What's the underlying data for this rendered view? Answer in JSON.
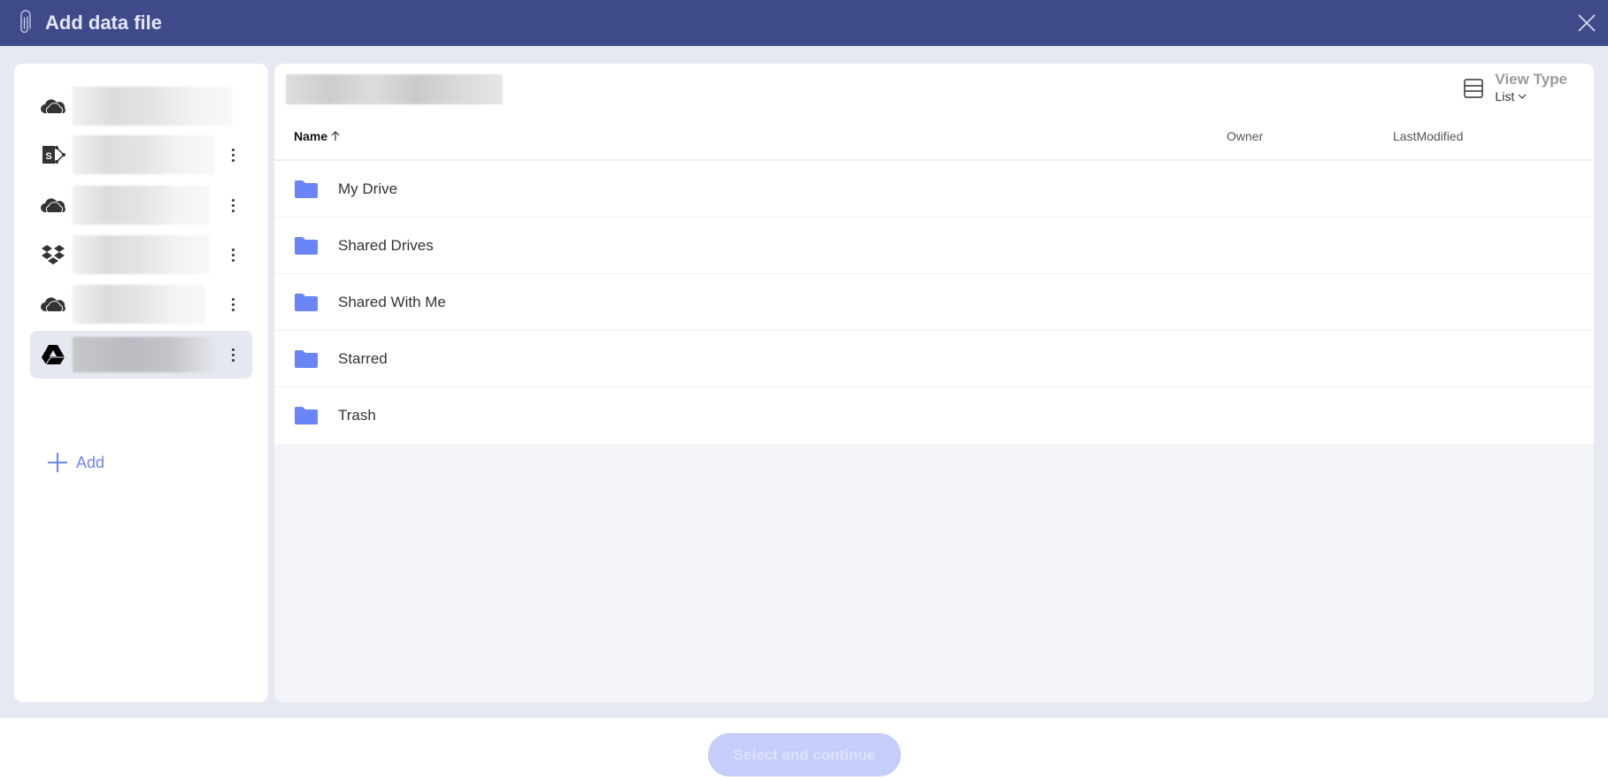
{
  "header": {
    "title": "Add data file",
    "icon": "paperclip-icon",
    "close_icon": "close-icon"
  },
  "sidebar": {
    "accounts": [
      {
        "icon": "onedrive-icon",
        "label": "",
        "selected": false,
        "has_menu": false
      },
      {
        "icon": "sharepoint-icon",
        "label": "",
        "selected": false,
        "has_menu": true
      },
      {
        "icon": "onedrive-icon",
        "label": "",
        "selected": false,
        "has_menu": true
      },
      {
        "icon": "dropbox-icon",
        "label": "",
        "selected": false,
        "has_menu": true
      },
      {
        "icon": "onedrive-icon",
        "label": "",
        "selected": false,
        "has_menu": true
      },
      {
        "icon": "google-drive-icon",
        "label": "",
        "selected": true,
        "has_menu": true
      }
    ],
    "add_label": "Add"
  },
  "browser": {
    "breadcrumb": "",
    "view_type": {
      "title": "View Type",
      "value": "List"
    },
    "columns": {
      "name": "Name",
      "name_sort": "ascending",
      "owner": "Owner",
      "last_modified": "LastModified"
    },
    "items": [
      {
        "name": "My Drive",
        "type": "folder",
        "owner": "",
        "last_modified": ""
      },
      {
        "name": "Shared Drives",
        "type": "folder",
        "owner": "",
        "last_modified": ""
      },
      {
        "name": "Shared With Me",
        "type": "folder",
        "owner": "",
        "last_modified": ""
      },
      {
        "name": "Starred",
        "type": "folder",
        "owner": "",
        "last_modified": ""
      },
      {
        "name": "Trash",
        "type": "folder",
        "owner": "",
        "last_modified": ""
      }
    ]
  },
  "footer": {
    "primary_label": "Select and continue",
    "primary_enabled": false
  },
  "colors": {
    "header_bg": "#3f4a8a",
    "accent": "#6b85f5",
    "folder": "#6b85f5",
    "button_disabled_bg": "#c5cefa"
  }
}
